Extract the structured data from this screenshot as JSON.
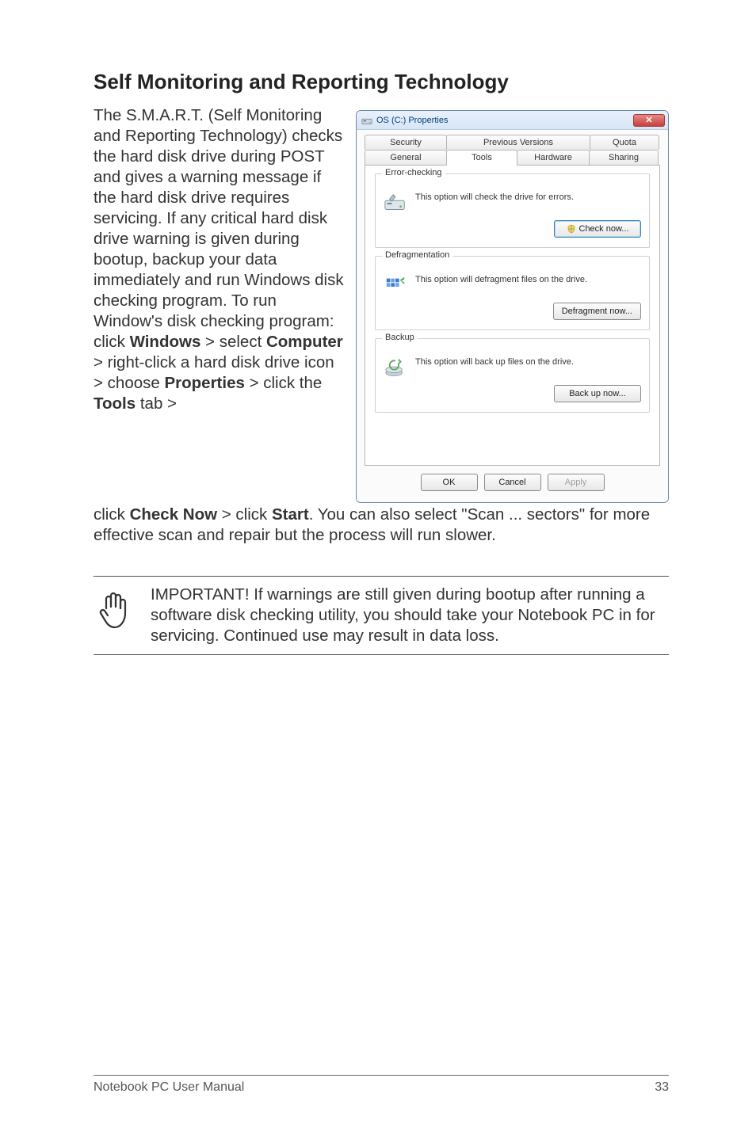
{
  "heading": "Self Monitoring and Reporting Technology",
  "para1_html": "The S.M.A.R.T. (Self Monitoring and Reporting Technology) checks the hard disk drive during POST and gives a warning message if the hard disk drive requires servicing. If any critical hard disk drive warning is given during bootup, backup your data immediately and run Windows disk checking program. To run Window's disk checking program: click <b>Windows</b> > select <b>Computer</b> > right-click a hard disk drive icon > choose <b>Properties</b> > click the <b>Tools</b> tab >",
  "para2_html": "click <b>Check Now</b> > click <b>Start</b>. You can also select \"Scan ... sectors\" for more effective scan and repair but the process will run slower.",
  "note": "IMPORTANT! If warnings are still given during bootup after running a software disk checking utility, you should take your Notebook PC in for servicing. Continued use may result in data loss.",
  "footer_left": "Notebook PC User Manual",
  "footer_right": "33",
  "dialog": {
    "title": "OS (C:) Properties",
    "tabs_top": [
      "Security",
      "Previous Versions",
      "Quota"
    ],
    "tabs_bottom": [
      "General",
      "Tools",
      "Hardware",
      "Sharing"
    ],
    "active_tab": "Tools",
    "groups": {
      "error": {
        "title": "Error-checking",
        "text": "This option will check the drive for errors.",
        "button": "Check now..."
      },
      "defrag": {
        "title": "Defragmentation",
        "text": "This option will defragment files on the drive.",
        "button": "Defragment now..."
      },
      "backup": {
        "title": "Backup",
        "text": "This option will back up files on the drive.",
        "button": "Back up now..."
      }
    },
    "footer_buttons": {
      "ok": "OK",
      "cancel": "Cancel",
      "apply": "Apply"
    }
  }
}
